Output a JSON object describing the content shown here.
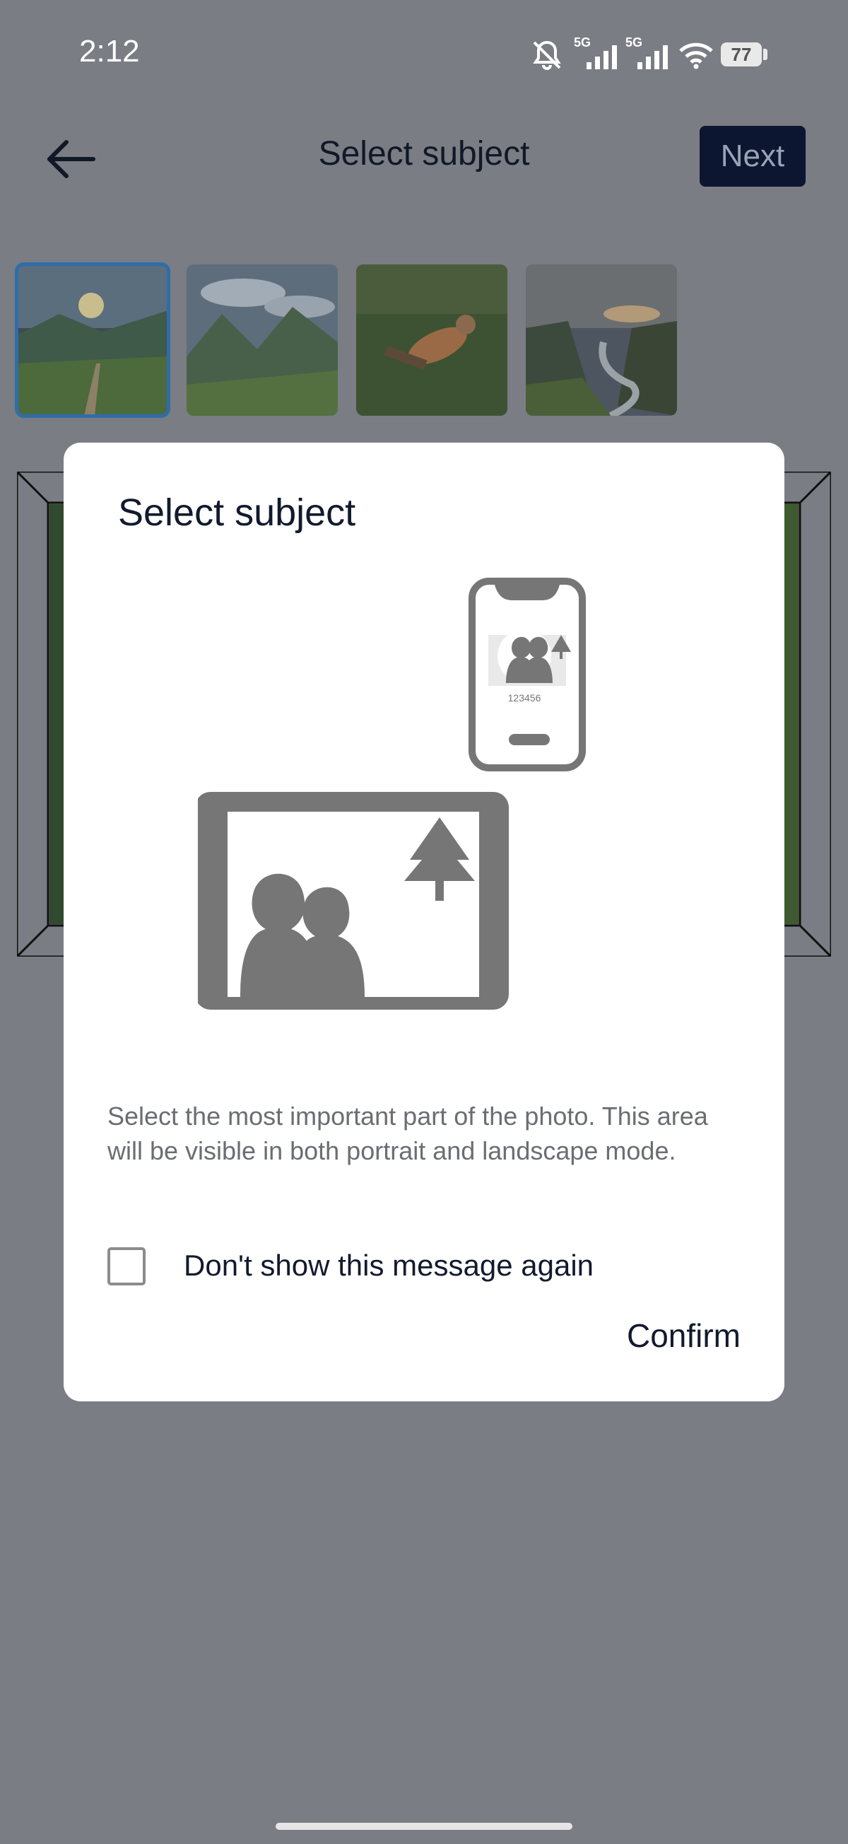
{
  "status_bar": {
    "time": "2:12",
    "network_1": "5G",
    "network_2": "5G",
    "battery": "77"
  },
  "header": {
    "title": "Select subject",
    "next_label": "Next"
  },
  "thumbnails": [
    {
      "name": "sunrise-valley-path",
      "selected": true
    },
    {
      "name": "mountain-village-valley",
      "selected": false
    },
    {
      "name": "person-lying-in-grass",
      "selected": false
    },
    {
      "name": "river-canyon-sunset",
      "selected": false
    }
  ],
  "dialog": {
    "title": "Select subject",
    "illustration_phone_text": "123456",
    "description": "Select the most important part of the photo. This area will be visible in both portrait and landscape mode.",
    "checkbox_label": "Don't show this message again",
    "checkbox_checked": false,
    "confirm_label": "Confirm"
  },
  "colors": {
    "overlay_background": "#7a7d83",
    "dialog_background": "#ffffff",
    "primary_text": "#121a2e",
    "secondary_text": "#6a6d73",
    "next_button_background": "#0d1630",
    "illustration_gray": "#767676",
    "illustration_arrow": "#d36a6a",
    "selected_thumb_border": "#2f6da8"
  }
}
